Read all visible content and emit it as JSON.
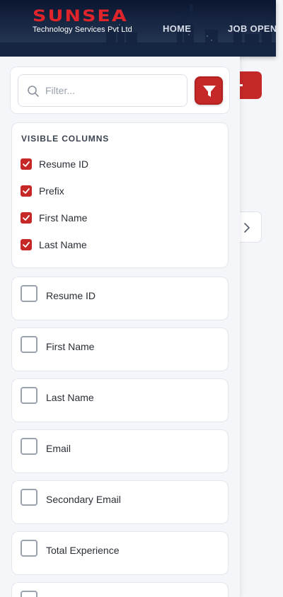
{
  "header": {
    "logo_word": "SUNSEA",
    "logo_sub": "Technology Services Pvt Ltd",
    "nav": [
      "HOME",
      "JOB OPENI"
    ]
  },
  "filter": {
    "placeholder": "Filter...",
    "icons": {
      "search": "search-icon",
      "filter": "funnel-icon"
    }
  },
  "visible_columns": {
    "title": "VISIBLE COLUMNS",
    "items": [
      "Resume ID",
      "Prefix",
      "First Name",
      "Last Name"
    ]
  },
  "columns": [
    "Resume ID",
    "First Name",
    "Last Name",
    "Email",
    "Secondary Email",
    "Total Experience"
  ],
  "colors": {
    "accent": "#c62828",
    "header_bg": "#1a2b4a",
    "logo_red": "#e0242b"
  }
}
